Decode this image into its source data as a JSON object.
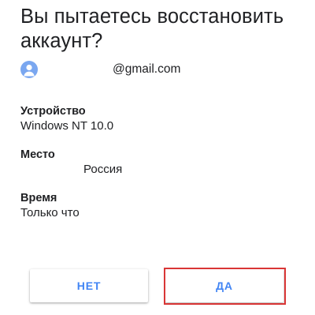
{
  "dialog": {
    "title": "Вы пытаетесь восстановить аккаунт?",
    "account": {
      "email_suffix": "@gmail.com",
      "avatar_icon": "person-avatar-icon",
      "avatar_color": "#7aa7f0"
    },
    "details": [
      {
        "label": "Устройство",
        "value": "Windows NT 10.0"
      },
      {
        "label": "Место",
        "value": "Россия"
      },
      {
        "label": "Время",
        "value": "Только что"
      }
    ]
  },
  "buttons": {
    "no_label": "НЕТ",
    "yes_label": "ДА",
    "accent_color": "#4285f4",
    "highlight_color": "#d93636"
  }
}
